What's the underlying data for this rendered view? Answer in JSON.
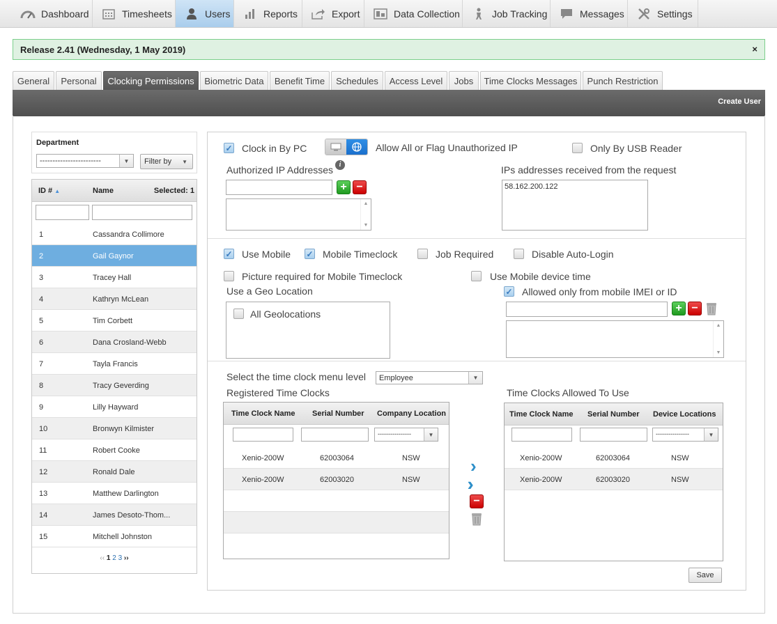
{
  "nav": [
    {
      "label": "Dashboard",
      "icon": "dashboard-icon"
    },
    {
      "label": "Timesheets",
      "icon": "calendar-icon"
    },
    {
      "label": "Users",
      "icon": "user-icon",
      "active": true
    },
    {
      "label": "Reports",
      "icon": "bar-chart-icon"
    },
    {
      "label": "Export",
      "icon": "export-icon"
    },
    {
      "label": "Data Collection",
      "icon": "data-collection-icon"
    },
    {
      "label": "Job Tracking",
      "icon": "job-tracking-icon"
    },
    {
      "label": "Messages",
      "icon": "chat-icon"
    },
    {
      "label": "Settings",
      "icon": "tools-icon"
    }
  ],
  "release": {
    "text": "Release 2.41 (Wednesday, 1 May 2019)",
    "close": "×"
  },
  "tabs": [
    "General",
    "Personal",
    "Clocking Permissions",
    "Biometric Data",
    "Benefit Time",
    "Schedules",
    "Access Level",
    "Jobs",
    "Time Clocks Messages",
    "Punch Restriction"
  ],
  "active_tab": "Clocking Permissions",
  "toolbar": {
    "create_user": "Create User"
  },
  "left": {
    "department_label": "Department",
    "department_value": "------------------------",
    "filter_label": "Filter by",
    "col_id": "ID #",
    "col_name": "Name",
    "selected": "Selected: 1",
    "users": [
      {
        "id": "1",
        "name": "Cassandra Collimore"
      },
      {
        "id": "2",
        "name": "Gail Gaynor"
      },
      {
        "id": "3",
        "name": "Tracey Hall"
      },
      {
        "id": "4",
        "name": "Kathryn McLean"
      },
      {
        "id": "5",
        "name": "Tim Corbett"
      },
      {
        "id": "6",
        "name": "Dana Crosland-Webb"
      },
      {
        "id": "7",
        "name": "Tayla Francis"
      },
      {
        "id": "8",
        "name": "Tracy Geverding"
      },
      {
        "id": "9",
        "name": "Lilly Hayward"
      },
      {
        "id": "10",
        "name": "Bronwyn Kilmister"
      },
      {
        "id": "11",
        "name": "Robert Cooke"
      },
      {
        "id": "12",
        "name": "Ronald Dale"
      },
      {
        "id": "13",
        "name": "Matthew Darlington"
      },
      {
        "id": "14",
        "name": "James Desoto-Thom..."
      },
      {
        "id": "15",
        "name": "Mitchell Johnston"
      }
    ],
    "selected_id": "2",
    "pager": {
      "prev": "‹‹",
      "pages": [
        "1",
        "2",
        "3"
      ],
      "next": "››",
      "current": "1"
    }
  },
  "perm": {
    "clock_in_pc": "Clock in By PC",
    "allow_all": "Allow All or Flag Unauthorized IP",
    "usb_only": "Only By USB Reader",
    "authorized_ip": "Authorized IP Addresses",
    "received_ip": "IPs addresses received from the request",
    "received_ip_value": "58.162.200.122",
    "use_mobile": "Use Mobile",
    "mobile_timeclock": "Mobile Timeclock",
    "job_required": "Job Required",
    "disable_autologin": "Disable Auto-Login",
    "picture_required": "Picture required for Mobile Timeclock",
    "use_mobile_time": "Use Mobile device time",
    "geo_location": "Use a Geo Location",
    "all_geolocations": "All Geolocations",
    "imei_only": "Allowed only from mobile IMEI or ID",
    "menu_level": "Select the time clock menu level",
    "menu_level_value": "Employee",
    "registered": "Registered Time Clocks",
    "allowed": "Time Clocks Allowed To Use",
    "save": "Save"
  },
  "checked": {
    "clock_in_pc": true,
    "usb_only": false,
    "use_mobile": true,
    "mobile_timeclock": true,
    "job_required": false,
    "disable_autologin": false,
    "picture_required": false,
    "use_mobile_time": false,
    "all_geolocations": false,
    "imei_only": true
  },
  "registered_grid": {
    "cols": [
      "Time Clock Name",
      "Serial Number",
      "Company Location"
    ],
    "filter_select": "----------------",
    "rows": [
      [
        "Xenio-200W",
        "62003064",
        "NSW"
      ],
      [
        "Xenio-200W",
        "62003020",
        "NSW"
      ]
    ]
  },
  "allowed_grid": {
    "cols": [
      "Time Clock Name",
      "Serial Number",
      "Device Locations"
    ],
    "filter_select": "----------------",
    "rows": [
      [
        "Xenio-200W",
        "62003064",
        "NSW"
      ],
      [
        "Xenio-200W",
        "62003020",
        "NSW"
      ]
    ]
  }
}
